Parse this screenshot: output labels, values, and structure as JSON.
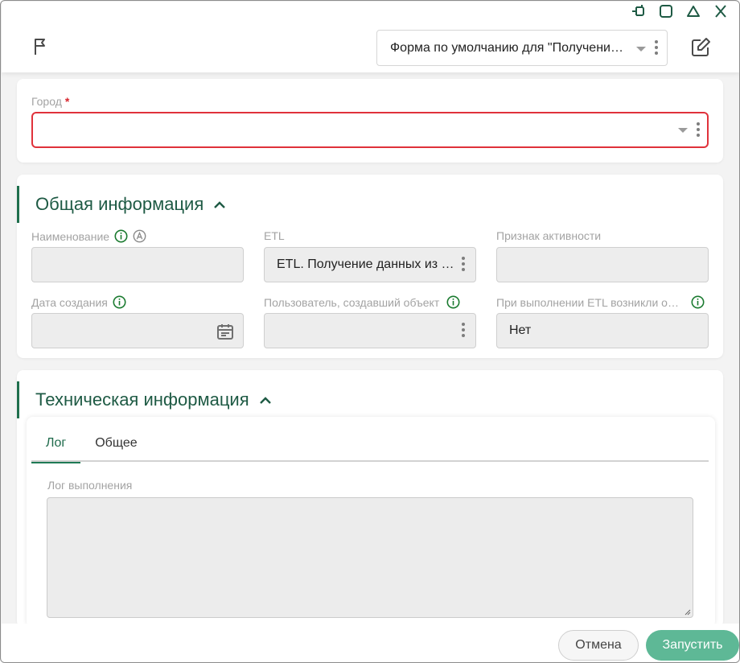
{
  "header": {
    "form_select_value": "Форма по умолчанию для \"Получение данных ETL\""
  },
  "city": {
    "label": "Город",
    "required_mark": "*",
    "value": ""
  },
  "general": {
    "title": "Общая информация",
    "fields": {
      "name_label": "Наименование",
      "name_value": "",
      "etl_label": "ETL",
      "etl_value": "ETL. Получение данных из внешнего источника",
      "active_label": "Признак активности",
      "active_value": "",
      "created_label": "Дата создания",
      "created_value": "",
      "creator_label": "Пользователь, создавший объект",
      "creator_value": "",
      "error_label": "При выполнении ETL возникли ошибки",
      "error_value": "Нет"
    }
  },
  "tech": {
    "title": "Техническая информация",
    "tabs": [
      "Лог",
      "Общее"
    ],
    "log_label": "Лог выполнения",
    "log_value": ""
  },
  "footer": {
    "cancel": "Отмена",
    "run": "Запустить"
  },
  "colors": {
    "accent": "#1f6f4d",
    "error": "#e0323b",
    "primary_button": "#5eb896"
  },
  "icons": [
    "pin-icon",
    "maximize-icon",
    "collapse-icon",
    "close-icon",
    "flag-icon",
    "edit-icon",
    "info-icon",
    "auto-icon",
    "calendar-icon",
    "chevron-up-icon",
    "chevron-down-icon",
    "kebab-icon"
  ]
}
